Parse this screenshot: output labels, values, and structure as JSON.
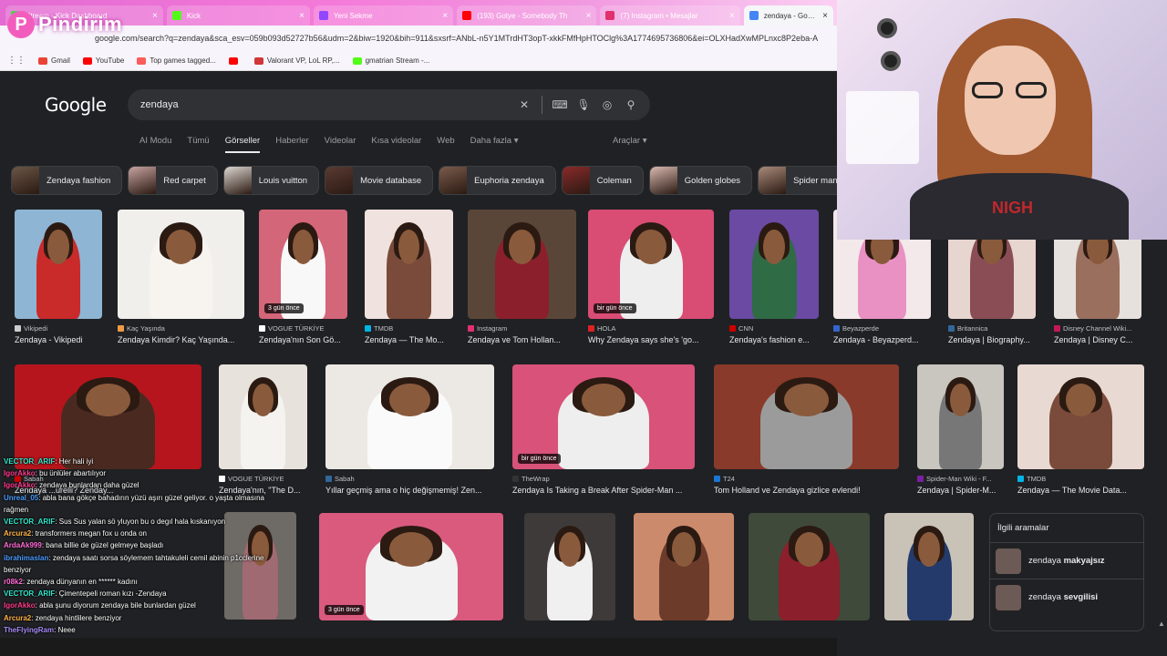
{
  "overlay": {
    "logo_letter": "P",
    "logo_text": "Pindirim"
  },
  "tabs": [
    {
      "label": "Stream - Kick Dashboard",
      "icon": "kick-icon",
      "active": false,
      "color": "#4fd14f"
    },
    {
      "label": "Kick",
      "icon": "kick-icon",
      "active": false,
      "color": "#53fc18"
    },
    {
      "label": "Yeni Sekme",
      "icon": "twitch-icon",
      "active": false,
      "color": "#9146ff"
    },
    {
      "label": "(193) Gotye - Somebody Th",
      "icon": "youtube-icon",
      "active": false,
      "color": "#ff0000"
    },
    {
      "label": "(7) Instagram • Mesajlar",
      "icon": "instagram-icon",
      "active": false,
      "color": "#e1306c"
    },
    {
      "label": "zendaya - Google'da A",
      "icon": "google-icon",
      "active": true,
      "color": "#4285f4"
    }
  ],
  "url": "google.com/search?q=zendaya&sca_esv=059b093d52727b56&udm=2&biw=1920&bih=911&sxsrf=ANbL-n5Y1MTrdHT3opT-xkkFMfHpHTOClg%3A1774695736806&ei=OLXHadXwMPLnxc8P2eba-A",
  "bookmarks": [
    {
      "label": "Gmail",
      "color": "#ea4335"
    },
    {
      "label": "YouTube",
      "color": "#ff0000"
    },
    {
      "label": "Top games tagged...",
      "color": "#fa5c5c"
    },
    {
      "label": "",
      "color": "#ff0000"
    },
    {
      "label": "Valorant VP, LoL RP,...",
      "color": "#d13639"
    },
    {
      "label": "gmatrian Stream -...",
      "color": "#53fc18"
    }
  ],
  "google": {
    "logo": "Google",
    "query": "zendaya",
    "nav": [
      "AI Modu",
      "Tümü",
      "Görseller",
      "Haberler",
      "Videolar",
      "Kısa videolar",
      "Web",
      "Daha fazla ▾"
    ],
    "active_nav": "Görseller",
    "tools": "Araçlar ▾",
    "chips": [
      {
        "label": "Zendaya fashion",
        "color": "#6b5646"
      },
      {
        "label": "Red carpet",
        "color": "#c7a3a0"
      },
      {
        "label": "Louis vuitton",
        "color": "#ddd6d0"
      },
      {
        "label": "Movie database",
        "color": "#5a3b33"
      },
      {
        "label": "Euphoria zendaya",
        "color": "#7a5b4c"
      },
      {
        "label": "Coleman",
        "color": "#8a2a2a"
      },
      {
        "label": "Golden globes",
        "color": "#d9b9b0"
      },
      {
        "label": "Spider man",
        "color": "#a88a7a"
      }
    ]
  },
  "images": [
    {
      "src": "Vikipedi",
      "title": "Zendaya - Vikipedi",
      "badge": "",
      "bg": "#8fb5d4",
      "outfit": "#c92a2a",
      "favc": "#ccc"
    },
    {
      "src": "Kaç Yaşında",
      "title": "Zendaya Kimdir? Kaç Yaşında...",
      "badge": "",
      "bg": "#f1efec",
      "outfit": "#f7f4f0",
      "favc": "#e94"
    },
    {
      "src": "VOGUE TÜRKİYE",
      "title": "Zendaya'nın Son Gö...",
      "badge": "3 gün önce",
      "bg": "#d4667a",
      "outfit": "#f8f8f8",
      "favc": "#fff"
    },
    {
      "src": "TMDB",
      "title": "Zendaya — The Mo...",
      "badge": "",
      "bg": "#f0e2df",
      "outfit": "#7a4b3a",
      "favc": "#01b4e4"
    },
    {
      "src": "Instagram",
      "title": "Zendaya ve Tom Hollan...",
      "badge": "",
      "bg": "#5a4638",
      "outfit": "#8b1f2b",
      "favc": "#e1306c"
    },
    {
      "src": "HOLA",
      "title": "Why Zendaya says she's 'go...",
      "badge": "bir gün önce",
      "bg": "#d94d75",
      "outfit": "#eee",
      "favc": "#d22"
    },
    {
      "src": "CNN",
      "title": "Zendaya's fashion e...",
      "badge": "",
      "bg": "#6a4aa3",
      "outfit": "#2f6b45",
      "favc": "#c00"
    },
    {
      "src": "Beyazperde",
      "title": "Zendaya - Beyazperd...",
      "badge": "",
      "bg": "#f3e9ea",
      "outfit": "#e991c3",
      "favc": "#36c"
    },
    {
      "src": "Britannica",
      "title": "Zendaya | Biography...",
      "badge": "",
      "bg": "#e7d5cf",
      "outfit": "#8a4d55",
      "favc": "#369"
    },
    {
      "src": "Disney Channel Wiki...",
      "title": "Zendaya | Disney C...",
      "badge": "",
      "bg": "#e6e1dd",
      "outfit": "#9b6f5e",
      "favc": "#c2185b"
    },
    {
      "src": "Sabah",
      "title": "Zendaya ...urelli? Zenday...",
      "badge": "",
      "bg": "#b7151d",
      "outfit": "#4a2a20",
      "favc": "#c00"
    },
    {
      "src": "VOGUE TÜRKİYE",
      "title": "Zendaya'nın, \"The D...",
      "badge": "",
      "bg": "#e7e2dc",
      "outfit": "#f5f3ef",
      "favc": "#fff"
    },
    {
      "src": "Sabah",
      "title": "Yıllar geçmiş ama o hiç değişmemiş! Zen...",
      "badge": "",
      "bg": "#ece9e4",
      "outfit": "#fafafa",
      "favc": "#369"
    },
    {
      "src": "TheWrap",
      "title": "Zendaya Is Taking a Break After Spider-Man ...",
      "badge": "bir gün önce",
      "bg": "#d8527a",
      "outfit": "#eee",
      "favc": "#333"
    },
    {
      "src": "T24",
      "title": "Tom Holland ve Zendaya gizlice evlendi!",
      "badge": "",
      "bg": "#8a3a2a",
      "outfit": "#9b9b9b",
      "favc": "#1976d2"
    },
    {
      "src": "Spider-Man Wiki - F...",
      "title": "Zendaya | Spider-M...",
      "badge": "",
      "bg": "#c9c5bf",
      "outfit": "#777",
      "favc": "#7b1fa2"
    },
    {
      "src": "TMDB",
      "title": "Zendaya — The Movie Data...",
      "badge": "",
      "bg": "#e8d9d2",
      "outfit": "#7a4b3a",
      "favc": "#01b4e4"
    },
    {
      "src": "",
      "title": "",
      "badge": "",
      "bg": "#6e6a66",
      "outfit": "#a06a72",
      "favc": "#999"
    },
    {
      "src": "",
      "title": "",
      "badge": "3 gün önce",
      "bg": "#d95a7d",
      "outfit": "#f2f2f2",
      "favc": "#999"
    },
    {
      "src": "",
      "title": "",
      "badge": "",
      "bg": "#3e3a3a",
      "outfit": "#f0f0f0",
      "favc": "#999"
    },
    {
      "src": "",
      "title": "",
      "badge": "",
      "bg": "#cc8a6c",
      "outfit": "#6d3b2a",
      "favc": "#999"
    },
    {
      "src": "",
      "title": "",
      "badge": "",
      "bg": "#3f4a3a",
      "outfit": "#8b1f2b",
      "favc": "#999"
    },
    {
      "src": "",
      "title": "",
      "badge": "",
      "bg": "#c9c2b7",
      "outfit": "#233a6b",
      "favc": "#999"
    }
  ],
  "related": {
    "heading": "İlgili aramalar",
    "items": [
      {
        "prefix": "zendaya ",
        "bold": "makyajsız"
      },
      {
        "prefix": "zendaya ",
        "bold": "sevgilisi"
      }
    ]
  },
  "webcam": {
    "shirt_text": "NIGH"
  },
  "chat": [
    {
      "user": "VECTOR_ARIF",
      "color": "#2ee6c9",
      "msg": "Her hali iyi"
    },
    {
      "user": "IgorAkko",
      "color": "#ff3b8d",
      "msg": "bu ünlüler abartılıyor"
    },
    {
      "user": "IgorAkko",
      "color": "#ff3b8d",
      "msg": "zendaya bunlardan daha güzel"
    },
    {
      "user": "Unreal_05",
      "color": "#4a9cff",
      "msg": "abla bana gökçe bahadırın yüzü aşırı güzel geliyor. o yaşta olmasına rağmen"
    },
    {
      "user": "VECTOR_ARIF",
      "color": "#2ee6c9",
      "msg": "Sus Sus yalan sö yluyon bu o degıl hala kıskanıyon"
    },
    {
      "user": "Arcura2",
      "color": "#ffb347",
      "msg": "transformers megan fox u onda on"
    },
    {
      "user": "ArdaAk999",
      "color": "#ff6ad5",
      "msg": "bana billie de güzel gelmeye başladı"
    },
    {
      "user": "ibrahimaslan",
      "color": "#4a9cff",
      "msg": "zendaya saatı sorsa söylemem tahtakuleli cemil abinin p1cclerine benziyor"
    },
    {
      "user": "r08k2",
      "color": "#ff6ad5",
      "msg": "zendaya dünyanın en ****** kadını"
    },
    {
      "user": "VECTOR_ARIF",
      "color": "#2ee6c9",
      "msg": "Çimentepeli roman kızı -Zendaya"
    },
    {
      "user": "IgorAkko",
      "color": "#ff3b8d",
      "msg": "abla şunu diyorum zendaya bile bunlardan güzel"
    },
    {
      "user": "Arcura2",
      "color": "#ffb347",
      "msg": "zendaya hintlilere benziyor"
    },
    {
      "user": "TheFlyingRam",
      "color": "#a78bfa",
      "msg": "Neee"
    }
  ]
}
